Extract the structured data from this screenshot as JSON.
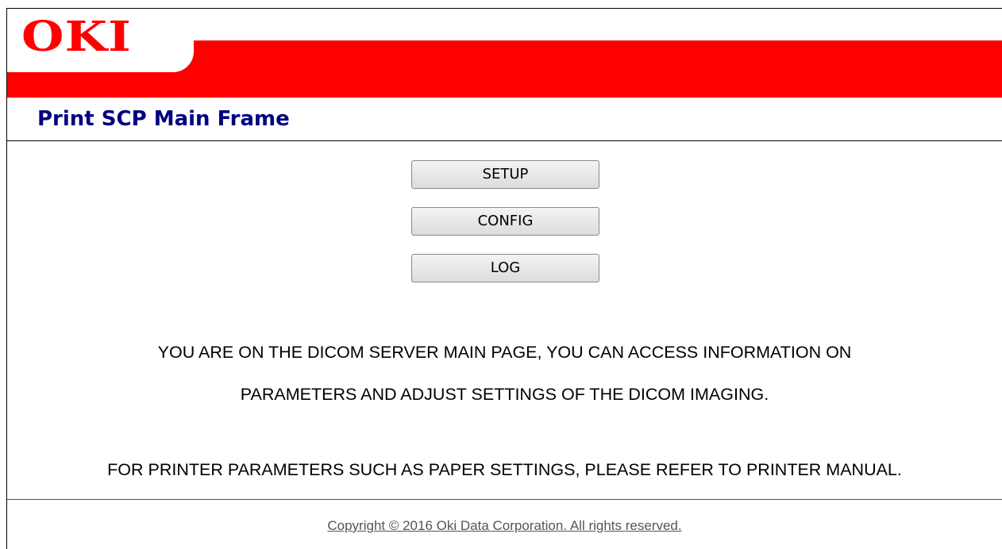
{
  "header": {
    "logo_text": "OKI",
    "brand_color": "#ff0000"
  },
  "page": {
    "title": "Print SCP Main Frame",
    "title_color": "#00007f"
  },
  "buttons": {
    "setup_label": "SETUP",
    "config_label": "CONFIG",
    "log_label": "LOG"
  },
  "messages": {
    "line1": "YOU ARE ON THE DICOM SERVER MAIN PAGE, YOU CAN ACCESS INFORMATION ON",
    "line2": "PARAMETERS AND ADJUST SETTINGS OF THE DICOM IMAGING.",
    "line3": "FOR PRINTER PARAMETERS SUCH AS PAPER SETTINGS, PLEASE REFER TO PRINTER MANUAL."
  },
  "footer": {
    "copyright": "Copyright © 2016 Oki Data Corporation. All rights reserved."
  }
}
